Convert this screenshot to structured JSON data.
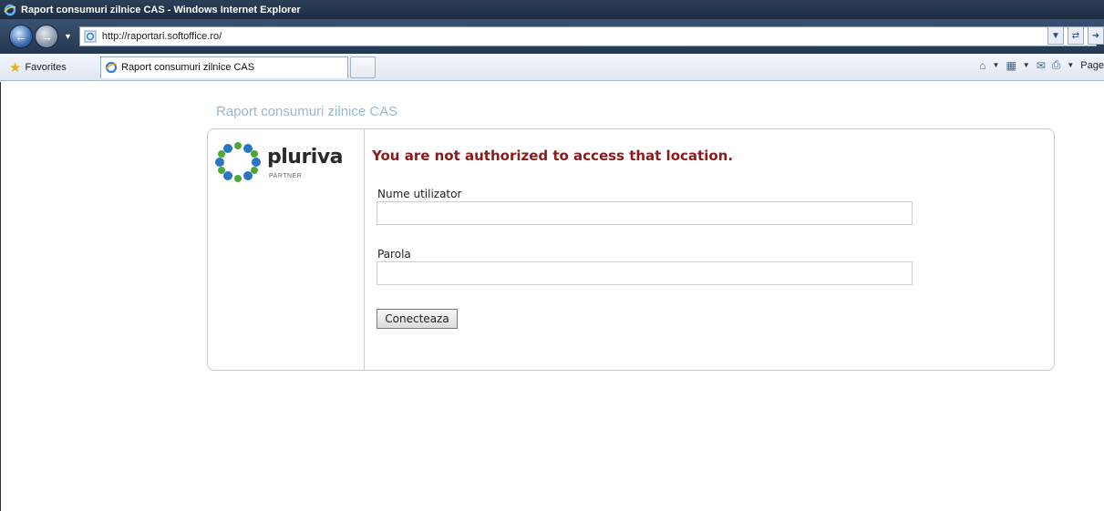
{
  "window": {
    "title": "Raport consumuri zilnice CAS - Windows Internet Explorer",
    "address": "http://raportari.softoffice.ro/",
    "icon": "ie-icon"
  },
  "toolbar": {
    "favorites_label": "Favorites",
    "tab_title": "Raport consumuri zilnice CAS",
    "page_label": "Page"
  },
  "page": {
    "heading": "Raport consumuri zilnice CAS",
    "logo_name": "pluriva",
    "logo_subtitle": "PARTNER",
    "error_message": "You are not authorized to access that location.",
    "username_label": "Nume utilizator",
    "username_value": "",
    "password_label": "Parola",
    "password_value": "",
    "submit_label": "Conecteaza"
  },
  "colors": {
    "heading": "#9ab9cf",
    "error": "#8b1a1a",
    "logo_blue": "#2b76c4",
    "logo_green": "#4da838"
  }
}
